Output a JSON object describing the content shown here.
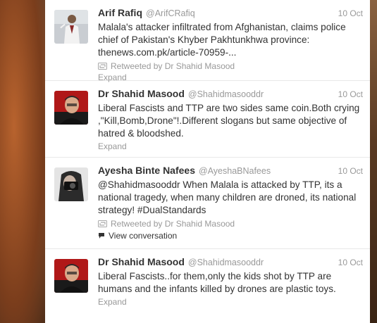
{
  "tweets": [
    {
      "fullname": "Arif Rafiq",
      "username": "@ArifCRafiq",
      "time": "10 Oct",
      "text": "Malala's attacker infiltrated from Afghanistan, claims police chief of Pakistan's Khyber Pakhtunkhwa province: thenews.com.pk/article-70959-...",
      "retweeted_by": "Retweeted by Dr Shahid Masood",
      "action": "Expand",
      "avatar_icon": "user-avatar-white-suit"
    },
    {
      "fullname": "Dr Shahid Masood",
      "username": "@Shahidmasooddr",
      "time": "10 Oct",
      "text": "Liberal Fascists and TTP are two sides same coin.Both crying ,\"Kill,Bomb,Drone\"!.Different slogans but same objective of hatred & bloodshed.",
      "action": "Expand",
      "avatar_icon": "user-avatar-red"
    },
    {
      "fullname": "Ayesha Binte Nafees",
      "username": "@AyeshaBNafees",
      "time": "10 Oct",
      "text": "@Shahidmasooddr When Malala is attacked by TTP, its a national tragedy, when many children are droned, its national strategy! #DualStandards",
      "retweeted_by": "Retweeted by Dr Shahid Masood",
      "conversation": "View conversation",
      "avatar_icon": "user-avatar-camera"
    },
    {
      "fullname": "Dr Shahid Masood",
      "username": "@Shahidmasooddr",
      "time": "10 Oct",
      "text": "Liberal Fascists..for them,only the kids shot by TTP are humans and the infants killed by drones are plastic toys.",
      "action": "Expand",
      "avatar_icon": "user-avatar-red"
    }
  ]
}
